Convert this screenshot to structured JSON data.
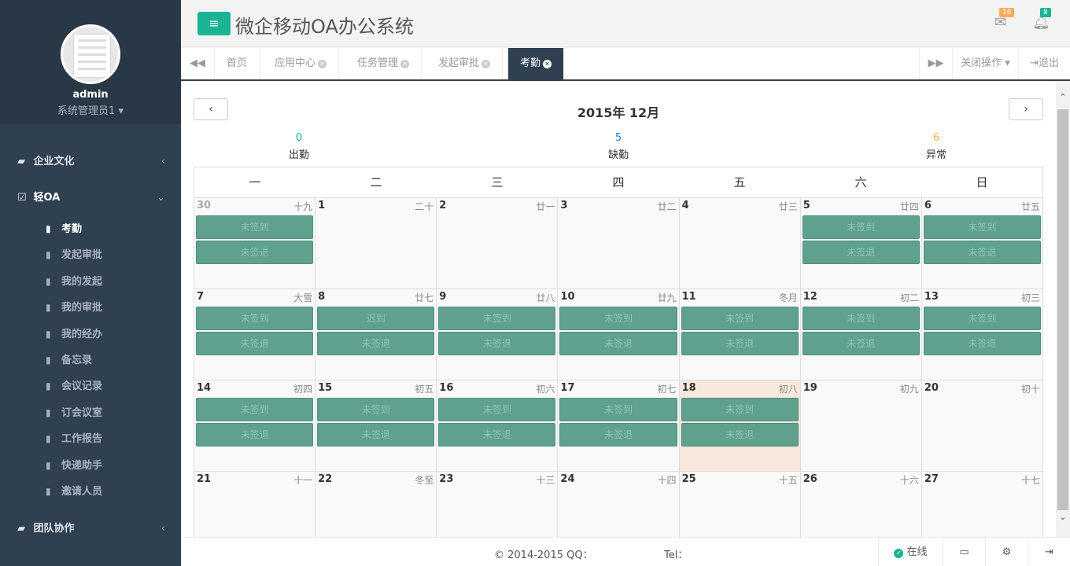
{
  "user": {
    "name": "admin",
    "role": "系统管理员1"
  },
  "sidebar": {
    "groups": [
      {
        "label": "企业文化"
      },
      {
        "label": "轻OA"
      },
      {
        "label": "团队协作"
      }
    ],
    "items": [
      {
        "label": "考勤"
      },
      {
        "label": "发起审批"
      },
      {
        "label": "我的发起"
      },
      {
        "label": "我的审批"
      },
      {
        "label": "我的经办"
      },
      {
        "label": "备忘录"
      },
      {
        "label": "会议记录"
      },
      {
        "label": "订会议室"
      },
      {
        "label": "工作报告"
      },
      {
        "label": "快递助手"
      },
      {
        "label": "邀请人员"
      }
    ]
  },
  "header": {
    "title": "微企移动OA办公系统",
    "mail_count": "16",
    "bell_count": "8",
    "badge_mail_color": "#f8ac59",
    "badge_bell_color": "#1ab394"
  },
  "tabs": {
    "items": [
      {
        "label": "首页"
      },
      {
        "label": "应用中心"
      },
      {
        "label": "任务管理"
      },
      {
        "label": "发起审批"
      },
      {
        "label": "考勤"
      }
    ],
    "close_ops": "关闭操作",
    "logout": "退出"
  },
  "calendar": {
    "title": "2015年 12月",
    "stats": [
      {
        "num": "0",
        "label": "出勤",
        "color": "#1ab394"
      },
      {
        "num": "5",
        "label": "缺勤",
        "color": "#1c84c6"
      },
      {
        "num": "6",
        "label": "异常",
        "color": "#f8ac59"
      }
    ],
    "weekdays": [
      "一",
      "二",
      "三",
      "四",
      "五",
      "六",
      "日"
    ],
    "weeks": [
      [
        {
          "d": "30",
          "l": "十九",
          "dim": true,
          "e": [
            "未签到",
            "未签退"
          ]
        },
        {
          "d": "1",
          "l": "二十",
          "e": []
        },
        {
          "d": "2",
          "l": "廿一",
          "e": []
        },
        {
          "d": "3",
          "l": "廿二",
          "e": []
        },
        {
          "d": "4",
          "l": "廿三",
          "e": []
        },
        {
          "d": "5",
          "l": "廿四",
          "e": [
            "未签到",
            "未签退"
          ]
        },
        {
          "d": "6",
          "l": "廿五",
          "e": [
            "未签到",
            "未签退"
          ]
        }
      ],
      [
        {
          "d": "7",
          "l": "大雪",
          "e": [
            "未签到",
            "未签退"
          ]
        },
        {
          "d": "8",
          "l": "廿七",
          "e": [
            "迟到",
            "未签退"
          ]
        },
        {
          "d": "9",
          "l": "廿八",
          "e": [
            "未签到",
            "未签退"
          ]
        },
        {
          "d": "10",
          "l": "廿九",
          "e": [
            "未签到",
            "未签退"
          ]
        },
        {
          "d": "11",
          "l": "冬月",
          "e": [
            "未签到",
            "未签退"
          ]
        },
        {
          "d": "12",
          "l": "初二",
          "e": [
            "未签到",
            "未签退"
          ]
        },
        {
          "d": "13",
          "l": "初三",
          "e": [
            "未签到",
            "未签退"
          ]
        }
      ],
      [
        {
          "d": "14",
          "l": "初四",
          "e": [
            "未签到",
            "未签退"
          ]
        },
        {
          "d": "15",
          "l": "初五",
          "e": [
            "未签到",
            "未签退"
          ]
        },
        {
          "d": "16",
          "l": "初六",
          "e": [
            "未签到",
            "未签退"
          ]
        },
        {
          "d": "17",
          "l": "初七",
          "e": [
            "未签到",
            "未签退"
          ]
        },
        {
          "d": "18",
          "l": "初八",
          "today": true,
          "e": [
            "未签到",
            "未签退"
          ]
        },
        {
          "d": "19",
          "l": "初九",
          "e": []
        },
        {
          "d": "20",
          "l": "初十",
          "e": []
        }
      ],
      [
        {
          "d": "21",
          "l": "十一",
          "e": []
        },
        {
          "d": "22",
          "l": "冬至",
          "e": []
        },
        {
          "d": "23",
          "l": "十三",
          "e": []
        },
        {
          "d": "24",
          "l": "十四",
          "e": []
        },
        {
          "d": "25",
          "l": "十五",
          "e": []
        },
        {
          "d": "26",
          "l": "十六",
          "e": []
        },
        {
          "d": "27",
          "l": "十七",
          "e": []
        }
      ]
    ]
  },
  "footer": {
    "copyright": "© 2014-2015  QQ：",
    "tel": "Tel：",
    "online": "在线"
  }
}
